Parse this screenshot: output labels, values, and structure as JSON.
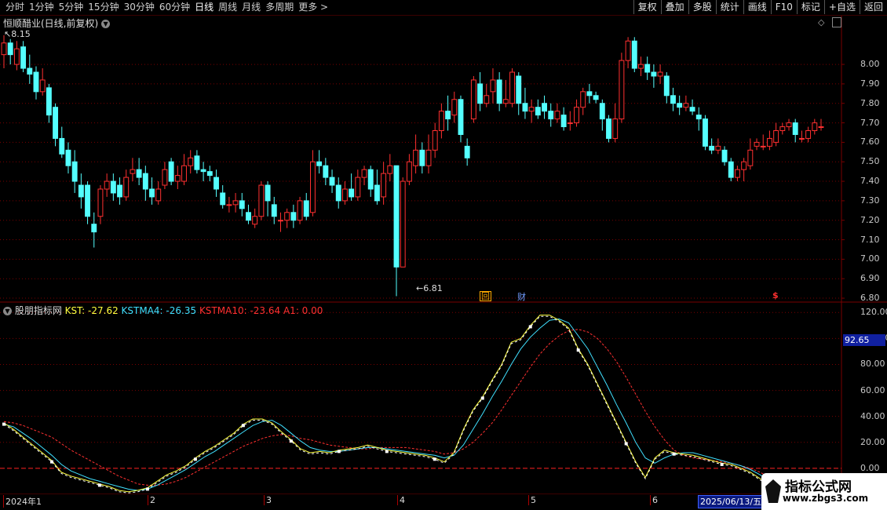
{
  "toolbar": {
    "periods": [
      "分时",
      "1分钟",
      "5分钟",
      "15分钟",
      "30分钟",
      "60分钟",
      "日线",
      "周线",
      "月线",
      "多周期",
      "更多 >"
    ],
    "active_period": "日线",
    "actions": [
      "复权",
      "叠加",
      "多股",
      "统计",
      "画线",
      "F10",
      "标记",
      "+自选",
      "返回"
    ]
  },
  "main_panel": {
    "title": "恒顺醋业(日线,前复权)",
    "high_label": "8.15",
    "low_label": "6.81",
    "price_ticks": [
      "8.00",
      "7.90",
      "7.80",
      "7.70",
      "7.60",
      "7.50",
      "7.40",
      "7.30",
      "7.20",
      "7.10",
      "7.00",
      "6.90",
      "6.80"
    ],
    "markers": [
      {
        "text": "回",
        "color": "#ffaa00"
      },
      {
        "text": "财",
        "color": "#6f9cff"
      },
      {
        "text": "$",
        "color": "#ff3030"
      }
    ]
  },
  "indicator_panel": {
    "name": "股朋指标网",
    "kst_label": "KST: -27.62",
    "kstma4_label": "KSTMA4: -26.35",
    "kstma10_label": "KSTMA10: -23.64",
    "a1_label": "A1: 0.00",
    "ticks": [
      "120.00",
      "100.00",
      "80.00",
      "60.00",
      "40.00",
      "20.00",
      "0.00"
    ],
    "current_value": "92.65"
  },
  "time_axis": {
    "labels": [
      "2024年1",
      "2",
      "3",
      "4",
      "5",
      "6"
    ],
    "current_date": "2025/06/13/五"
  },
  "watermark": {
    "title": "指标公式网",
    "url": "www.zbgs3.com"
  },
  "colors": {
    "up": "#ff3030",
    "down": "#54ffff",
    "kst": "#ffff40",
    "kstma4": "#40e0ff",
    "kstma10": "#ff3030",
    "grid": "#7a0000"
  },
  "chart_data": {
    "type": "candlestick",
    "price_range": [
      6.78,
      8.25
    ],
    "candles": [
      [
        8.05,
        8.11,
        8.15,
        7.98
      ],
      [
        8.11,
        8.05,
        8.13,
        8.0
      ],
      [
        8.0,
        8.08,
        8.12,
        7.97
      ],
      [
        8.09,
        7.98,
        8.12,
        7.96
      ],
      [
        7.98,
        7.95,
        8.05,
        7.9
      ],
      [
        7.96,
        7.86,
        7.99,
        7.82
      ],
      [
        7.86,
        7.92,
        7.98,
        7.84
      ],
      [
        7.88,
        7.74,
        7.9,
        7.7
      ],
      [
        7.78,
        7.62,
        7.8,
        7.58
      ],
      [
        7.62,
        7.54,
        7.68,
        7.52
      ],
      [
        7.56,
        7.48,
        7.6,
        7.44
      ],
      [
        7.5,
        7.4,
        7.56,
        7.34
      ],
      [
        7.38,
        7.32,
        7.44,
        7.26
      ],
      [
        7.38,
        7.22,
        7.4,
        7.18
      ],
      [
        7.18,
        7.14,
        7.24,
        7.06
      ],
      [
        7.22,
        7.36,
        7.38,
        7.18
      ],
      [
        7.36,
        7.4,
        7.44,
        7.32
      ],
      [
        7.4,
        7.34,
        7.44,
        7.3
      ],
      [
        7.38,
        7.32,
        7.42,
        7.28
      ],
      [
        7.32,
        7.42,
        7.46,
        7.3
      ],
      [
        7.44,
        7.46,
        7.52,
        7.4
      ],
      [
        7.46,
        7.42,
        7.52,
        7.38
      ],
      [
        7.44,
        7.36,
        7.48,
        7.3
      ],
      [
        7.36,
        7.32,
        7.42,
        7.28
      ],
      [
        7.3,
        7.36,
        7.4,
        7.28
      ],
      [
        7.38,
        7.46,
        7.5,
        7.36
      ],
      [
        7.5,
        7.4,
        7.52,
        7.38
      ],
      [
        7.4,
        7.43,
        7.48,
        7.36
      ],
      [
        7.4,
        7.48,
        7.54,
        7.38
      ],
      [
        7.48,
        7.52,
        7.56,
        7.44
      ],
      [
        7.53,
        7.46,
        7.56,
        7.44
      ],
      [
        7.46,
        7.45,
        7.5,
        7.4
      ],
      [
        7.45,
        7.43,
        7.48,
        7.4
      ],
      [
        7.42,
        7.36,
        7.46,
        7.32
      ],
      [
        7.34,
        7.28,
        7.38,
        7.26
      ],
      [
        7.28,
        7.28,
        7.32,
        7.24
      ],
      [
        7.28,
        7.3,
        7.34,
        7.24
      ],
      [
        7.3,
        7.26,
        7.34,
        7.22
      ],
      [
        7.24,
        7.2,
        7.28,
        7.18
      ],
      [
        7.18,
        7.22,
        7.26,
        7.16
      ],
      [
        7.22,
        7.38,
        7.4,
        7.2
      ],
      [
        7.38,
        7.3,
        7.4,
        7.22
      ],
      [
        7.28,
        7.22,
        7.32,
        7.18
      ],
      [
        7.2,
        7.2,
        7.24,
        7.14
      ],
      [
        7.2,
        7.24,
        7.26,
        7.16
      ],
      [
        7.24,
        7.2,
        7.28,
        7.16
      ],
      [
        7.2,
        7.3,
        7.32,
        7.18
      ],
      [
        7.3,
        7.22,
        7.34,
        7.2
      ],
      [
        7.24,
        7.5,
        7.56,
        7.22
      ],
      [
        7.5,
        7.48,
        7.56,
        7.44
      ],
      [
        7.48,
        7.42,
        7.52,
        7.38
      ],
      [
        7.42,
        7.38,
        7.46,
        7.34
      ],
      [
        7.38,
        7.3,
        7.42,
        7.26
      ],
      [
        7.3,
        7.36,
        7.4,
        7.28
      ],
      [
        7.36,
        7.32,
        7.44,
        7.3
      ],
      [
        7.32,
        7.42,
        7.46,
        7.3
      ],
      [
        7.42,
        7.46,
        7.48,
        7.38
      ],
      [
        7.46,
        7.36,
        7.48,
        7.32
      ],
      [
        7.38,
        7.3,
        7.46,
        7.28
      ],
      [
        7.32,
        7.44,
        7.5,
        7.28
      ],
      [
        7.44,
        7.48,
        7.54,
        7.4
      ],
      [
        7.48,
        6.96,
        7.48,
        6.81
      ],
      [
        6.96,
        7.4,
        7.42,
        6.96
      ],
      [
        7.4,
        7.5,
        7.54,
        7.38
      ],
      [
        7.48,
        7.56,
        7.64,
        7.44
      ],
      [
        7.56,
        7.48,
        7.6,
        7.44
      ],
      [
        7.48,
        7.56,
        7.64,
        7.44
      ],
      [
        7.56,
        7.66,
        7.7,
        7.52
      ],
      [
        7.66,
        7.76,
        7.8,
        7.62
      ],
      [
        7.76,
        7.72,
        7.84,
        7.66
      ],
      [
        7.74,
        7.82,
        7.86,
        7.7
      ],
      [
        7.82,
        7.64,
        7.84,
        7.6
      ],
      [
        7.58,
        7.52,
        7.62,
        7.48
      ],
      [
        7.72,
        7.92,
        7.94,
        7.7
      ],
      [
        7.9,
        7.8,
        7.96,
        7.76
      ],
      [
        7.8,
        7.84,
        7.9,
        7.78
      ],
      [
        7.86,
        7.92,
        7.98,
        7.8
      ],
      [
        7.92,
        7.8,
        7.96,
        7.76
      ],
      [
        7.8,
        7.82,
        7.92,
        7.78
      ],
      [
        7.8,
        7.96,
        7.98,
        7.78
      ],
      [
        7.94,
        7.8,
        7.96,
        7.74
      ],
      [
        7.8,
        7.76,
        7.88,
        7.72
      ],
      [
        7.76,
        7.78,
        7.82,
        7.7
      ],
      [
        7.78,
        7.74,
        7.82,
        7.72
      ],
      [
        7.8,
        7.76,
        7.84,
        7.72
      ],
      [
        7.76,
        7.72,
        7.8,
        7.68
      ],
      [
        7.72,
        7.76,
        7.8,
        7.7
      ],
      [
        7.74,
        7.68,
        7.78,
        7.66
      ],
      [
        7.7,
        7.7,
        7.76,
        7.66
      ],
      [
        7.7,
        7.78,
        7.82,
        7.68
      ],
      [
        7.78,
        7.86,
        7.88,
        7.74
      ],
      [
        7.86,
        7.84,
        7.9,
        7.8
      ],
      [
        7.84,
        7.82,
        7.86,
        7.8
      ],
      [
        7.8,
        7.72,
        7.82,
        7.66
      ],
      [
        7.72,
        7.62,
        7.74,
        7.6
      ],
      [
        7.62,
        7.72,
        7.8,
        7.6
      ],
      [
        7.72,
        8.02,
        8.06,
        7.7
      ],
      [
        8.02,
        8.12,
        8.14,
        7.98
      ],
      [
        8.12,
        7.98,
        8.14,
        7.96
      ],
      [
        7.98,
        8.0,
        8.04,
        7.94
      ],
      [
        8.0,
        7.96,
        8.04,
        7.92
      ],
      [
        7.96,
        7.94,
        8.0,
        7.88
      ],
      [
        7.94,
        7.96,
        8.0,
        7.9
      ],
      [
        7.94,
        7.84,
        7.96,
        7.8
      ],
      [
        7.84,
        7.8,
        7.88,
        7.76
      ],
      [
        7.8,
        7.78,
        7.84,
        7.74
      ],
      [
        7.78,
        7.8,
        7.84,
        7.76
      ],
      [
        7.78,
        7.76,
        7.82,
        7.74
      ],
      [
        7.74,
        7.72,
        7.78,
        7.66
      ],
      [
        7.72,
        7.58,
        7.74,
        7.56
      ],
      [
        7.58,
        7.56,
        7.62,
        7.54
      ],
      [
        7.56,
        7.58,
        7.62,
        7.54
      ],
      [
        7.56,
        7.5,
        7.58,
        7.48
      ],
      [
        7.5,
        7.42,
        7.52,
        7.4
      ],
      [
        7.42,
        7.46,
        7.48,
        7.4
      ],
      [
        7.46,
        7.5,
        7.52,
        7.4
      ],
      [
        7.48,
        7.56,
        7.62,
        7.46
      ],
      [
        7.58,
        7.6,
        7.62,
        7.56
      ],
      [
        7.58,
        7.58,
        7.64,
        7.56
      ],
      [
        7.58,
        7.62,
        7.66,
        7.56
      ],
      [
        7.6,
        7.66,
        7.7,
        7.58
      ],
      [
        7.66,
        7.68,
        7.7,
        7.64
      ],
      [
        7.68,
        7.7,
        7.72,
        7.66
      ],
      [
        7.7,
        7.64,
        7.72,
        7.6
      ],
      [
        7.62,
        7.62,
        7.66,
        7.6
      ],
      [
        7.62,
        7.66,
        7.68,
        7.6
      ],
      [
        7.66,
        7.7,
        7.72,
        7.64
      ],
      [
        7.68,
        7.68,
        7.72,
        7.66
      ]
    ],
    "indicator_range": [
      -20,
      128
    ],
    "kst": [
      35,
      30,
      24,
      18,
      12,
      6,
      -3,
      -6,
      -8,
      -10,
      -12,
      -14,
      -17,
      -18,
      -17,
      -15,
      -10,
      -5,
      -2,
      2,
      8,
      13,
      17,
      22,
      27,
      34,
      38,
      38,
      35,
      28,
      22,
      15,
      12,
      13,
      12,
      14,
      15,
      16,
      18,
      16,
      14,
      13,
      12,
      11,
      10,
      8,
      5,
      12,
      30,
      45,
      55,
      68,
      80,
      97,
      100,
      110,
      118,
      118,
      114,
      108,
      92,
      80,
      65,
      50,
      35,
      20,
      5,
      -7,
      8,
      14,
      12,
      11,
      10,
      8,
      6,
      4,
      3,
      0,
      -3,
      -8,
      -12,
      -18,
      -27.62
    ],
    "kstma4": [
      34,
      32,
      27,
      22,
      16,
      10,
      3,
      -2,
      -5,
      -8,
      -10,
      -12,
      -14,
      -16,
      -17,
      -16,
      -13,
      -9,
      -5,
      -1,
      4,
      9,
      13,
      18,
      23,
      28,
      33,
      36,
      37,
      33,
      27,
      21,
      16,
      14,
      13,
      13,
      14,
      15,
      16,
      16,
      15,
      14,
      13,
      12,
      11,
      10,
      8,
      10,
      18,
      30,
      42,
      55,
      67,
      80,
      92,
      101,
      108,
      114,
      115,
      112,
      102,
      92,
      78,
      64,
      49,
      35,
      20,
      8,
      4,
      8,
      11,
      12,
      12,
      10,
      8,
      6,
      4,
      2,
      -1,
      -5,
      -10,
      -15,
      -26.35
    ],
    "kstma10": [
      36,
      35,
      33,
      30,
      27,
      24,
      19,
      14,
      10,
      6,
      2,
      -2,
      -6,
      -9,
      -12,
      -13,
      -13,
      -12,
      -10,
      -7,
      -3,
      1,
      5,
      9,
      13,
      17,
      20,
      23,
      25,
      26,
      25,
      23,
      22,
      20,
      18,
      17,
      16,
      15,
      15,
      16,
      16,
      16,
      16,
      15,
      14,
      13,
      11,
      12,
      15,
      20,
      27,
      35,
      45,
      56,
      67,
      78,
      88,
      96,
      102,
      106,
      107,
      105,
      100,
      92,
      82,
      70,
      57,
      44,
      32,
      22,
      14,
      10,
      8,
      7,
      6,
      5,
      4,
      2,
      0,
      -3,
      -7,
      -12,
      -23.64
    ]
  }
}
